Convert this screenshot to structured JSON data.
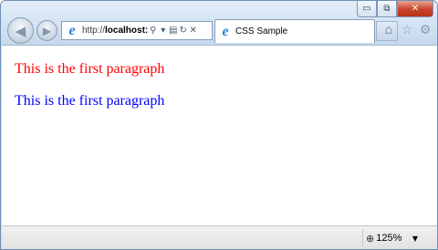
{
  "window": {
    "caption": {
      "minimize": "▭",
      "restore": "⧉",
      "close": "✕"
    }
  },
  "nav": {
    "back_icon": "arrow-left",
    "forward_icon": "arrow-right"
  },
  "address_bar": {
    "scheme": "http://",
    "host": "localhost:",
    "search_glyph": "⚲",
    "dropdown_glyph": "▾",
    "compat_glyph": "▤",
    "refresh_glyph": "↻",
    "stop_glyph": "✕"
  },
  "tab": {
    "title": "CSS Sample",
    "favicon": "ie-icon"
  },
  "toolbar": {
    "home_glyph": "⌂",
    "favorites_glyph": "☆",
    "settings_glyph": "⚙"
  },
  "content": {
    "paragraphs": [
      {
        "text": "This is the first paragraph",
        "color": "#ff0000"
      },
      {
        "text": "This is the first paragraph",
        "color": "#0000ff"
      }
    ]
  },
  "status": {
    "zoom_glyph": "⊕",
    "zoom_level": "125%",
    "zoom_dropdown": "▼"
  }
}
